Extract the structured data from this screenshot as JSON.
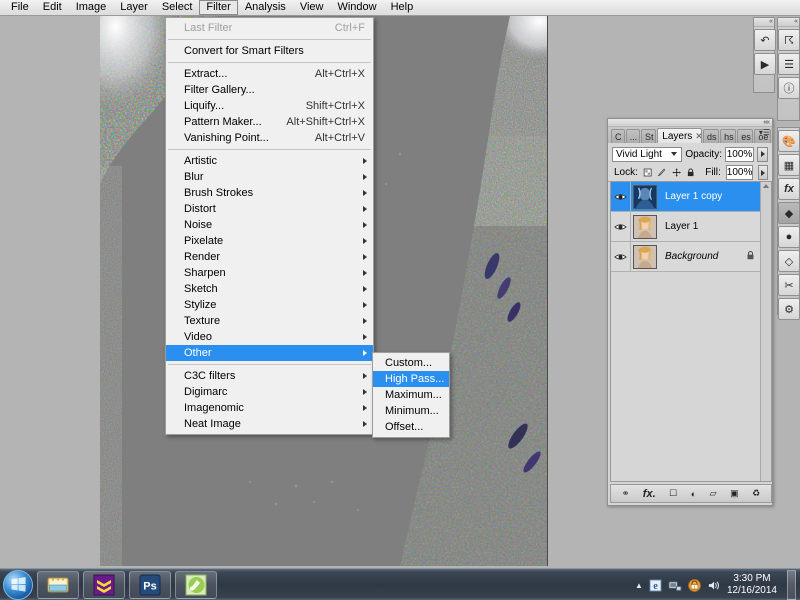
{
  "app": {
    "name": "Adobe Photoshop",
    "menubar": [
      {
        "label": "File",
        "active": false
      },
      {
        "label": "Edit",
        "active": false
      },
      {
        "label": "Image",
        "active": false
      },
      {
        "label": "Layer",
        "active": false
      },
      {
        "label": "Select",
        "active": false
      },
      {
        "label": "Filter",
        "active": true
      },
      {
        "label": "Analysis",
        "active": false
      },
      {
        "label": "View",
        "active": false
      },
      {
        "label": "Window",
        "active": false
      },
      {
        "label": "Help",
        "active": false
      }
    ]
  },
  "filter_menu": {
    "open": true,
    "items": [
      {
        "label": "Last Filter",
        "accel": "Ctrl+F",
        "disabled": true,
        "submenu": false
      },
      {
        "separator": true
      },
      {
        "label": "Convert for Smart Filters",
        "accel": "",
        "disabled": false,
        "submenu": false
      },
      {
        "separator": true
      },
      {
        "label": "Extract...",
        "accel": "Alt+Ctrl+X",
        "disabled": false,
        "submenu": false
      },
      {
        "label": "Filter Gallery...",
        "accel": "",
        "disabled": false,
        "submenu": false
      },
      {
        "label": "Liquify...",
        "accel": "Shift+Ctrl+X",
        "disabled": false,
        "submenu": false
      },
      {
        "label": "Pattern Maker...",
        "accel": "Alt+Shift+Ctrl+X",
        "disabled": false,
        "submenu": false
      },
      {
        "label": "Vanishing Point...",
        "accel": "Alt+Ctrl+V",
        "disabled": false,
        "submenu": false
      },
      {
        "separator": true
      },
      {
        "label": "Artistic",
        "accel": "",
        "disabled": false,
        "submenu": true
      },
      {
        "label": "Blur",
        "accel": "",
        "disabled": false,
        "submenu": true
      },
      {
        "label": "Brush Strokes",
        "accel": "",
        "disabled": false,
        "submenu": true
      },
      {
        "label": "Distort",
        "accel": "",
        "disabled": false,
        "submenu": true
      },
      {
        "label": "Noise",
        "accel": "",
        "disabled": false,
        "submenu": true
      },
      {
        "label": "Pixelate",
        "accel": "",
        "disabled": false,
        "submenu": true
      },
      {
        "label": "Render",
        "accel": "",
        "disabled": false,
        "submenu": true
      },
      {
        "label": "Sharpen",
        "accel": "",
        "disabled": false,
        "submenu": true
      },
      {
        "label": "Sketch",
        "accel": "",
        "disabled": false,
        "submenu": true
      },
      {
        "label": "Stylize",
        "accel": "",
        "disabled": false,
        "submenu": true
      },
      {
        "label": "Texture",
        "accel": "",
        "disabled": false,
        "submenu": true
      },
      {
        "label": "Video",
        "accel": "",
        "disabled": false,
        "submenu": true
      },
      {
        "label": "Other",
        "accel": "",
        "disabled": false,
        "submenu": true,
        "highlighted": true
      },
      {
        "separator": true
      },
      {
        "label": "C3C filters",
        "accel": "",
        "disabled": false,
        "submenu": true
      },
      {
        "label": "Digimarc",
        "accel": "",
        "disabled": false,
        "submenu": true
      },
      {
        "label": "Imagenomic",
        "accel": "",
        "disabled": false,
        "submenu": true
      },
      {
        "label": "Neat Image",
        "accel": "",
        "disabled": false,
        "submenu": true
      }
    ]
  },
  "other_submenu": {
    "open": true,
    "items": [
      {
        "label": "Custom...",
        "highlighted": false
      },
      {
        "label": "High Pass...",
        "highlighted": true
      },
      {
        "label": "Maximum...",
        "highlighted": false
      },
      {
        "label": "Minimum...",
        "highlighted": false
      },
      {
        "label": "Offset...",
        "highlighted": false
      }
    ]
  },
  "layers_panel": {
    "tabs": [
      {
        "label": "C",
        "active": false
      },
      {
        "label": "...",
        "active": false
      },
      {
        "label": "St",
        "active": false
      },
      {
        "label": "Layers",
        "active": true,
        "closable": true
      },
      {
        "label": "ds",
        "active": false
      },
      {
        "label": "hs",
        "active": false
      },
      {
        "label": "es",
        "active": false
      },
      {
        "label": "oe",
        "active": false
      }
    ],
    "blend_mode": "Vivid Light",
    "opacity_label": "Opacity:",
    "opacity_value": "100%",
    "lock_label": "Lock:",
    "lock_icons": [
      "lock-transparent-icon",
      "lock-image-icon",
      "lock-position-icon",
      "lock-all-icon"
    ],
    "fill_label": "Fill:",
    "fill_value": "100%",
    "layers": [
      {
        "name": "Layer 1 copy",
        "visible": true,
        "selected": true,
        "locked": false,
        "italic": false,
        "thumb": "blue"
      },
      {
        "name": "Layer 1",
        "visible": true,
        "selected": false,
        "locked": false,
        "italic": false,
        "thumb": "portrait"
      },
      {
        "name": "Background",
        "visible": true,
        "selected": false,
        "locked": true,
        "italic": true,
        "thumb": "portrait"
      }
    ],
    "footer_icons": [
      "link-layers-icon",
      "layer-style-fx-icon",
      "layer-mask-icon",
      "adjustment-layer-icon",
      "new-group-icon",
      "new-layer-icon",
      "delete-layer-icon"
    ]
  },
  "right_dock_top_left": {
    "collapse_label": "«",
    "icons": [
      "history-icon",
      "actions-play-icon"
    ]
  },
  "right_dock_top_right": {
    "collapse_label": "«",
    "icons": [
      "navigator-icon",
      "histogram-icon",
      "info-icon"
    ]
  },
  "right_dock_lower": {
    "icons": [
      "color-swatches-icon",
      "swatches-grid-icon",
      "styles-fx-icon",
      "layers-stack-icon",
      "channels-sphere-icon",
      "paths-icon",
      "brushes-icon",
      "tool-presets-icon"
    ],
    "active_icon": "layers-stack-icon"
  },
  "taskbar": {
    "start_button": "start-orb-icon",
    "buttons": [
      {
        "name": "windows-explorer-icon",
        "label": ""
      },
      {
        "name": "app-purple-icon",
        "label": ""
      },
      {
        "name": "photoshop-icon",
        "label": "Ps"
      },
      {
        "name": "app-green-icon",
        "label": ""
      }
    ],
    "tray": {
      "overflow": "▲",
      "icons": [
        "internet-explorer-icon",
        "network-icon",
        "security-warning-icon",
        "volume-icon"
      ],
      "time": "3:30 PM",
      "date": "12/16/2014"
    }
  },
  "colors": {
    "highlight": "#2b8fef",
    "menu_bg": "#f0f0f0",
    "panel_bg": "#d4d4d4",
    "workspace_bg": "#b4b4b4",
    "canvas_gray": "#7f7f7f",
    "taskbar": "#2f3845"
  }
}
